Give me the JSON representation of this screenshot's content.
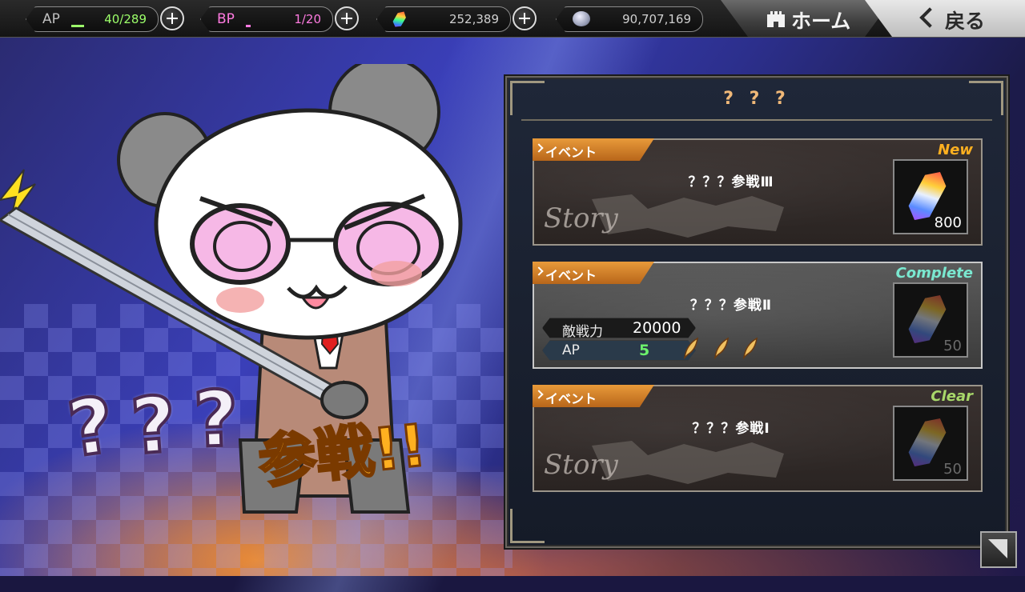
{
  "topbar": {
    "ap": {
      "label": "AP",
      "value": "40/289",
      "bar_fraction": 0.14,
      "color": "#9cff6a"
    },
    "bp": {
      "label": "BP",
      "value": "1/20",
      "bar_fraction": 0.05,
      "color": "#ff7ae0"
    },
    "gems": {
      "value": "252,389",
      "icon": "rainbow-crystal-icon"
    },
    "coins": {
      "value": "90,707,169",
      "icon": "silver-coin-icon"
    },
    "home_label": "ホーム",
    "back_label": "戻る"
  },
  "banner": {
    "marks": [
      "?",
      "?",
      "?"
    ],
    "text": "参戦!!"
  },
  "panel": {
    "title": "? ? ?",
    "quests": [
      {
        "tag": "イベント",
        "status": "New",
        "status_color": "#ffb020",
        "name": "？？？参戦Ⅲ",
        "type": "story",
        "story_label": "Story",
        "reward_count": "800",
        "dim": false
      },
      {
        "tag": "イベント",
        "status": "Complete",
        "status_color": "#7ae8d0",
        "name": "？？？参戦Ⅱ",
        "type": "battle",
        "enemy_label": "敵戦力",
        "enemy_power": "20000",
        "ap_label": "AP",
        "ap_cost": "5",
        "feathers": 3,
        "reward_count": "50",
        "dim": true
      },
      {
        "tag": "イベント",
        "status": "Clear",
        "status_color": "#a8d86a",
        "name": "？？？参戦Ⅰ",
        "type": "story",
        "story_label": "Story",
        "reward_count": "50",
        "dim": true
      }
    ]
  }
}
